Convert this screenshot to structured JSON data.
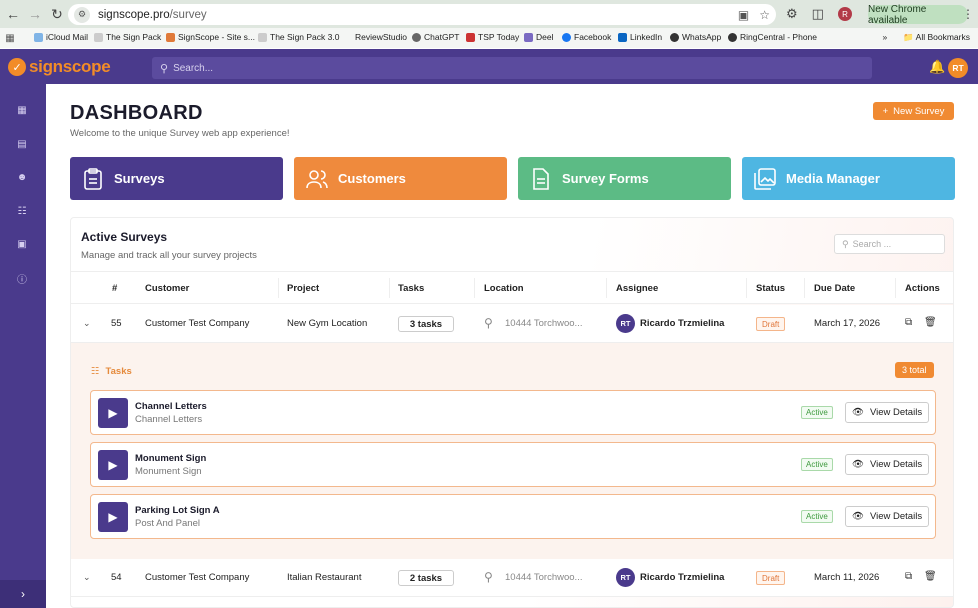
{
  "browser": {
    "url_host": "signscope.pro",
    "url_path": "/survey",
    "new_chrome_label": "New Chrome available",
    "profile_initial": "R",
    "bookmarks": [
      "iCloud Mail",
      "The Sign Pack",
      "SignScope - Site s...",
      "The Sign Pack 3.0",
      "ReviewStudio",
      "ChatGPT",
      "TSP Today",
      "Deel",
      "Facebook",
      "LinkedIn",
      "WhatsApp",
      "RingCentral - Phone"
    ],
    "all_bookmarks_label": "All Bookmarks"
  },
  "app": {
    "logo_text": "signscope",
    "search_placeholder": "Search...",
    "user_initials": "RT"
  },
  "page": {
    "title": "DASHBOARD",
    "subtitle": "Welcome to the unique Survey web app experience!",
    "new_survey_label": "New Survey"
  },
  "tiles": [
    {
      "label": "Surveys",
      "color": "#4a3a8c",
      "icon": "clipboard-icon"
    },
    {
      "label": "Customers",
      "color": "#ef8a3d",
      "icon": "users-icon"
    },
    {
      "label": "Survey Forms",
      "color": "#5cbb85",
      "icon": "document-icon"
    },
    {
      "label": "Media Manager",
      "color": "#4eb6e2",
      "icon": "images-icon"
    }
  ],
  "active_surveys": {
    "title": "Active Surveys",
    "subtitle": "Manage and track all your survey projects",
    "search_placeholder": "Search ...",
    "columns": [
      "#",
      "Customer",
      "Project",
      "Tasks",
      "Location",
      "Assignee",
      "Status",
      "Due Date",
      "Actions"
    ],
    "rows": [
      {
        "id": "55",
        "customer": "Customer Test Company",
        "project": "New Gym Location",
        "tasks": "3 tasks",
        "location": "10444 Torchwoo...",
        "assignee_initials": "RT",
        "assignee": "Ricardo Trzmielina",
        "status": "Draft",
        "due": "March 17, 2026"
      },
      {
        "id": "54",
        "customer": "Customer Test Company",
        "project": "Italian Restaurant",
        "tasks": "2 tasks",
        "location": "10444 Torchwoo...",
        "assignee_initials": "RT",
        "assignee": "Ricardo Trzmielina",
        "status": "Draft",
        "due": "March 11, 2026"
      }
    ],
    "expanded_tasks": {
      "label": "Tasks",
      "total": "3 total",
      "items": [
        {
          "name": "Channel Letters",
          "type": "Channel Letters",
          "status": "Active",
          "action": "View Details"
        },
        {
          "name": "Monument Sign",
          "type": "Monument Sign",
          "status": "Active",
          "action": "View Details"
        },
        {
          "name": "Parking Lot Sign A",
          "type": "Post And Panel",
          "status": "Active",
          "action": "View Details"
        }
      ]
    }
  }
}
